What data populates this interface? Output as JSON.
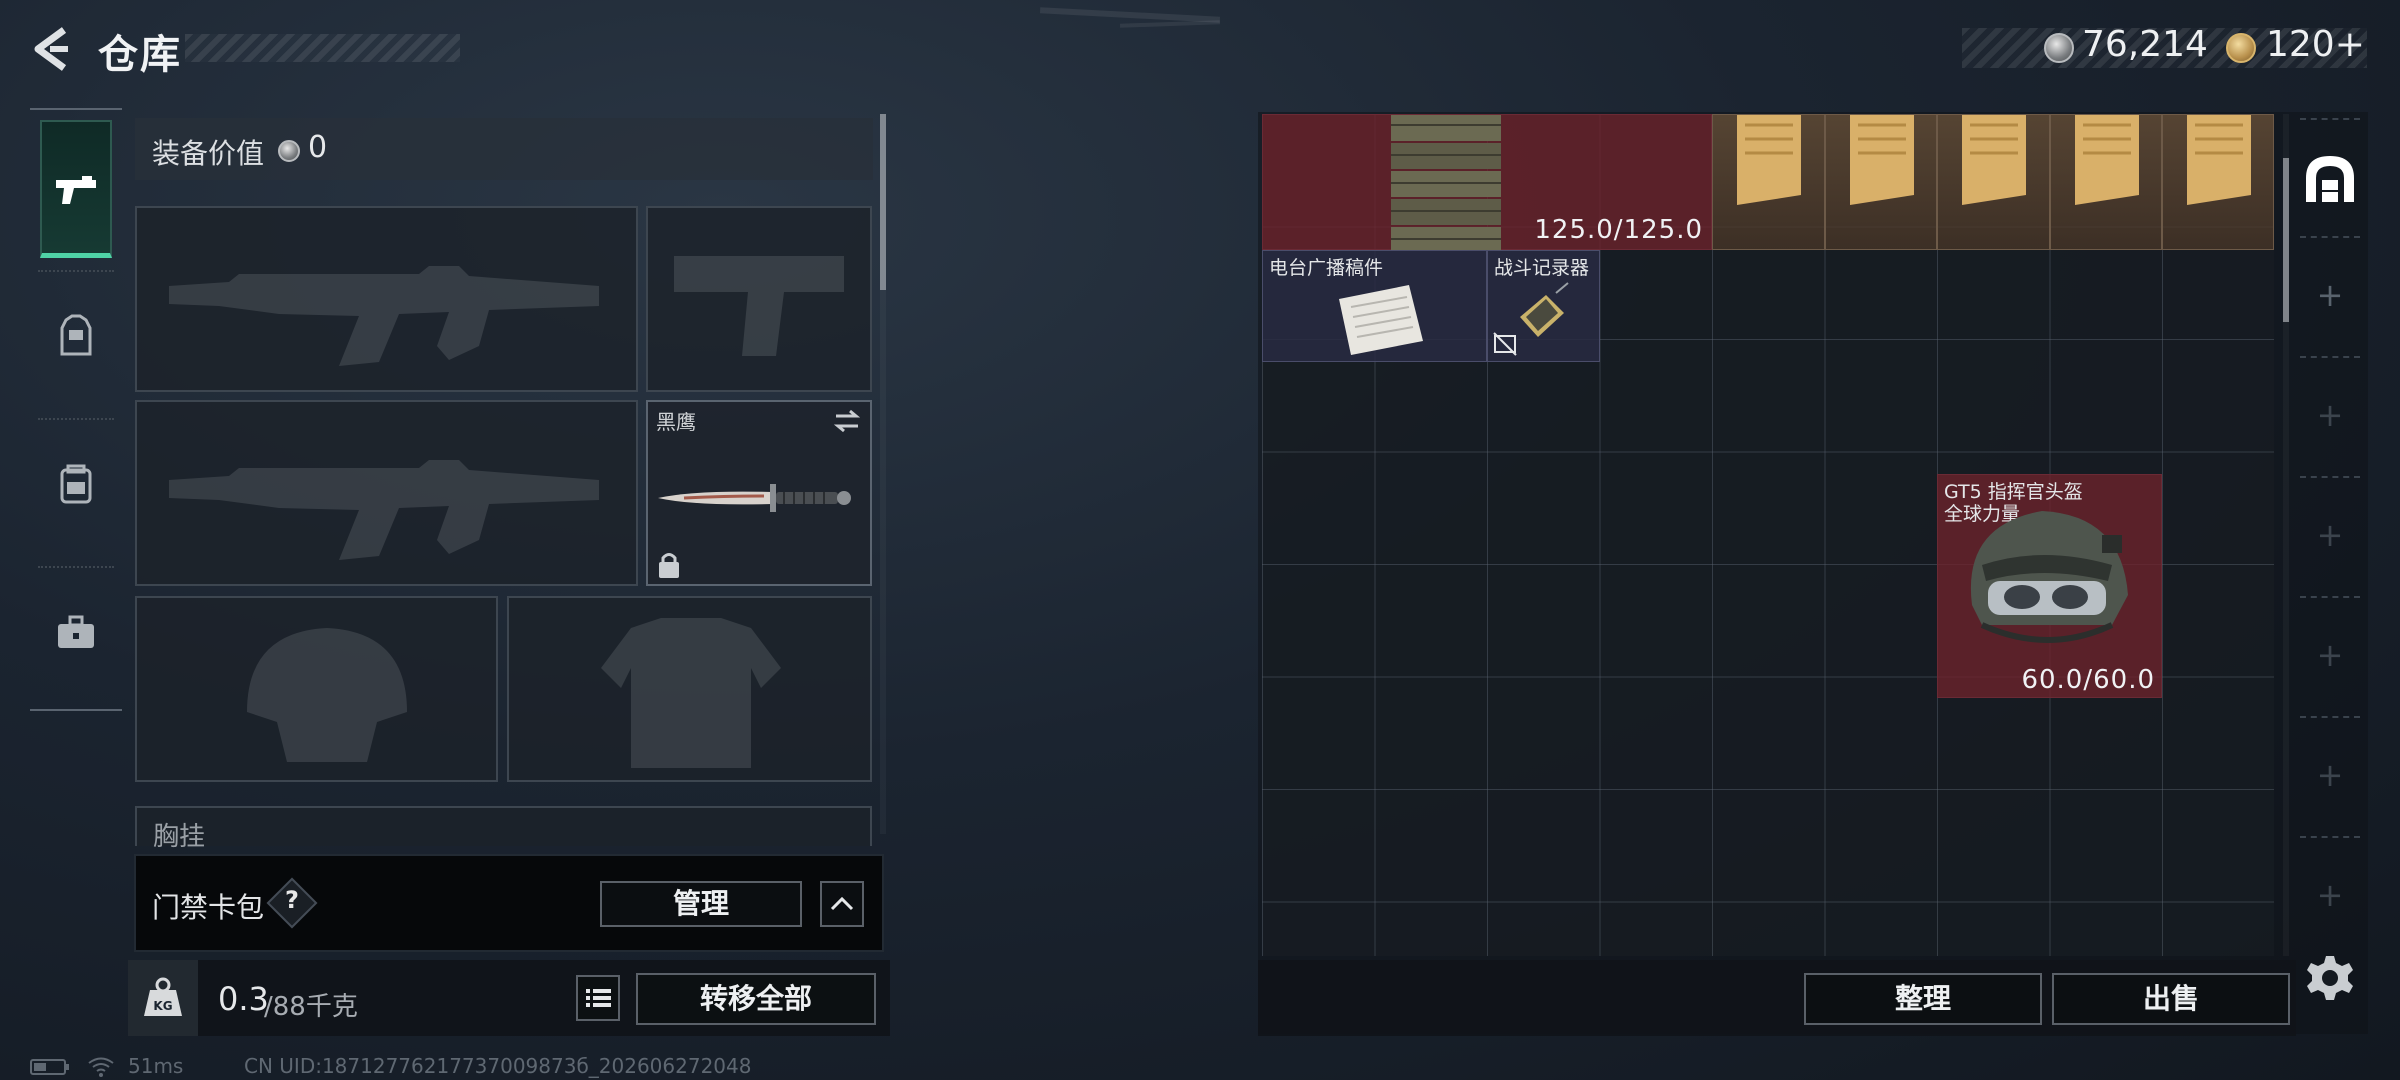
{
  "header": {
    "title": "仓库",
    "currency_primary": "76,214",
    "currency_secondary": "120+"
  },
  "left_nav": {
    "items": [
      {
        "name": "weapons",
        "icon": "pistol-icon",
        "active": true
      },
      {
        "name": "armor",
        "icon": "vest-icon",
        "active": false
      },
      {
        "name": "backpack",
        "icon": "backpack-icon",
        "active": false
      },
      {
        "name": "supplies",
        "icon": "toolbox-icon",
        "active": false
      }
    ]
  },
  "equipment": {
    "value_label": "装备价值",
    "value": "0",
    "slots": [
      {
        "name": "primary-weapon-slot",
        "item": ""
      },
      {
        "name": "pistol-slot",
        "item": ""
      },
      {
        "name": "secondary-weapon-slot",
        "item": ""
      },
      {
        "name": "melee-slot",
        "item": "黑鹰",
        "locked": true
      },
      {
        "name": "helmet-slot",
        "item": ""
      },
      {
        "name": "armor-slot",
        "item": ""
      }
    ],
    "next_section_label": "胸挂"
  },
  "access_card": {
    "label": "门禁卡包",
    "help": "?",
    "manage_label": "管理"
  },
  "weight": {
    "current": "0.3",
    "capacity": "/88千克",
    "transfer_all_label": "转移全部"
  },
  "status_bar": {
    "ping": "51ms",
    "uid": "CN UID:18712776217737009873б_202606272048"
  },
  "inventory": {
    "items": [
      {
        "name": "ammo-crate",
        "durability": "125.0/125.0"
      },
      {
        "name": "radio-broadcast-draft",
        "label": "电台广播稿件"
      },
      {
        "name": "combat-recorder",
        "label": "战斗记录器"
      },
      {
        "name": "gt5-commander-helmet",
        "label_line1": "GT5 指挥官头盔",
        "label_line2": "全球力量",
        "durability": "60.0/60.0"
      }
    ],
    "sort_label": "整理",
    "sell_label": "出售"
  },
  "side_tabs": {
    "plus_symbol": "+"
  },
  "colors": {
    "accent_green": "#4fd3a6",
    "item_red": "#6e222c",
    "item_purple": "#28294a",
    "item_gold": "#785a3c"
  }
}
